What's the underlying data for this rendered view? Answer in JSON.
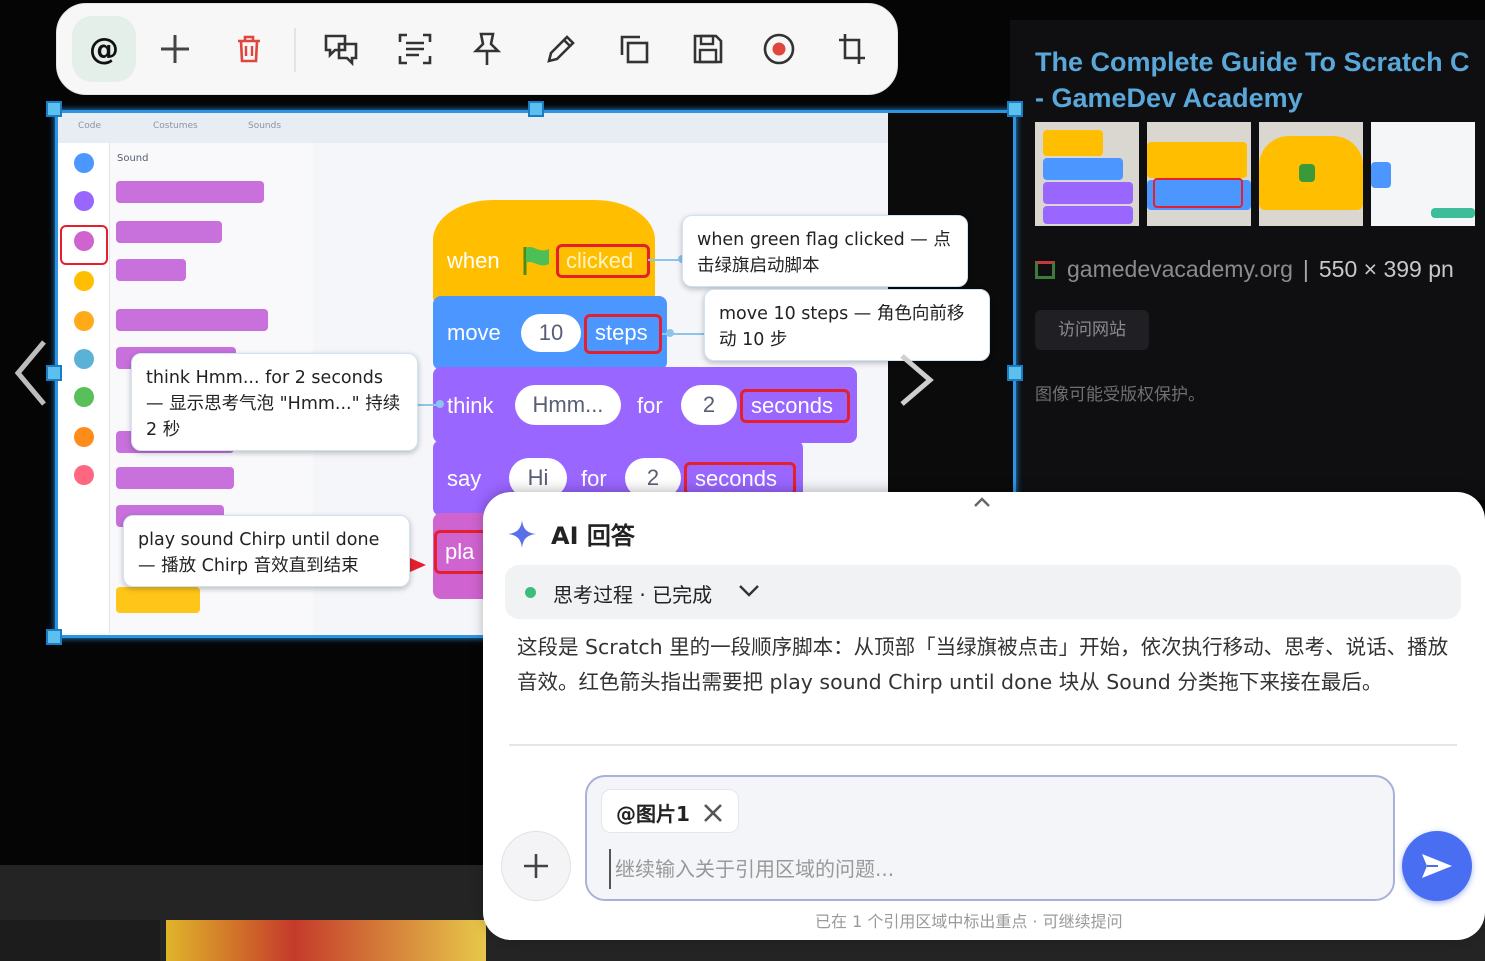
{
  "toolbar": {
    "mention_label": "@",
    "buttons": [
      "add-icon",
      "trash-icon",
      "chat-icon",
      "scan-text-icon",
      "pin-icon",
      "pen-icon",
      "copy-icon",
      "save-icon",
      "record-icon",
      "crop-icon"
    ]
  },
  "image_panel": {
    "title_line1": "The Complete Guide To Scratch C",
    "title_line2": "- GameDev Academy",
    "source": "gamedevacademy.org",
    "separator": "|",
    "size": "550 × 399 pn",
    "visit": "访问网站",
    "copyright": "图像可能受版权保护。"
  },
  "scratch": {
    "tabs": [
      "Code",
      "Costumes",
      "Sounds"
    ],
    "palette_header": "Sound",
    "hat_when": "when",
    "hat_clicked": "clicked",
    "move": "move",
    "move_num": "10",
    "move_steps": "steps",
    "think": "think",
    "think_msg": "Hmm...",
    "think_for": "for",
    "think_secs": "2",
    "think_seconds": "seconds",
    "say": "say",
    "say_msg": "Hi",
    "say_for": "for",
    "say_secs": "2",
    "say_seconds": "seconds",
    "play": "pla"
  },
  "callouts": {
    "flag": "when green flag clicked — 点击绿旗启动脚本",
    "move": "move 10 steps — 角色向前移动 10 步",
    "think": "think Hmm... for 2 seconds — 显示思考气泡 \"Hmm...\" 持续 2 秒",
    "sound": "play sound Chirp until done — 播放 Chirp 音效直到结束"
  },
  "ai": {
    "title": "AI 回答",
    "thinking": "思考过程 · 已完成",
    "answer": "这段是 Scratch 里的一段顺序脚本：从顶部「当绿旗被点击」开始，依次执行移动、思考、说话、播放音效。红色箭头指出需要把 play sound Chirp until done 块从 Sound 分类拖下来接在最后。",
    "chip": "@图片1",
    "placeholder": "继续输入关于引用区域的问题...",
    "footnote": "已在 1 个引用区域中标出重点 · 可继续提问"
  },
  "colors": {
    "accent": "#2b95e3",
    "scratch_events": "#ffbf00",
    "scratch_motion": "#4c97ff",
    "scratch_looks": "#9966ff",
    "scratch_sound": "#cf63cf",
    "highlight_red": "#e5202e",
    "send_button": "#4a6ef2"
  }
}
